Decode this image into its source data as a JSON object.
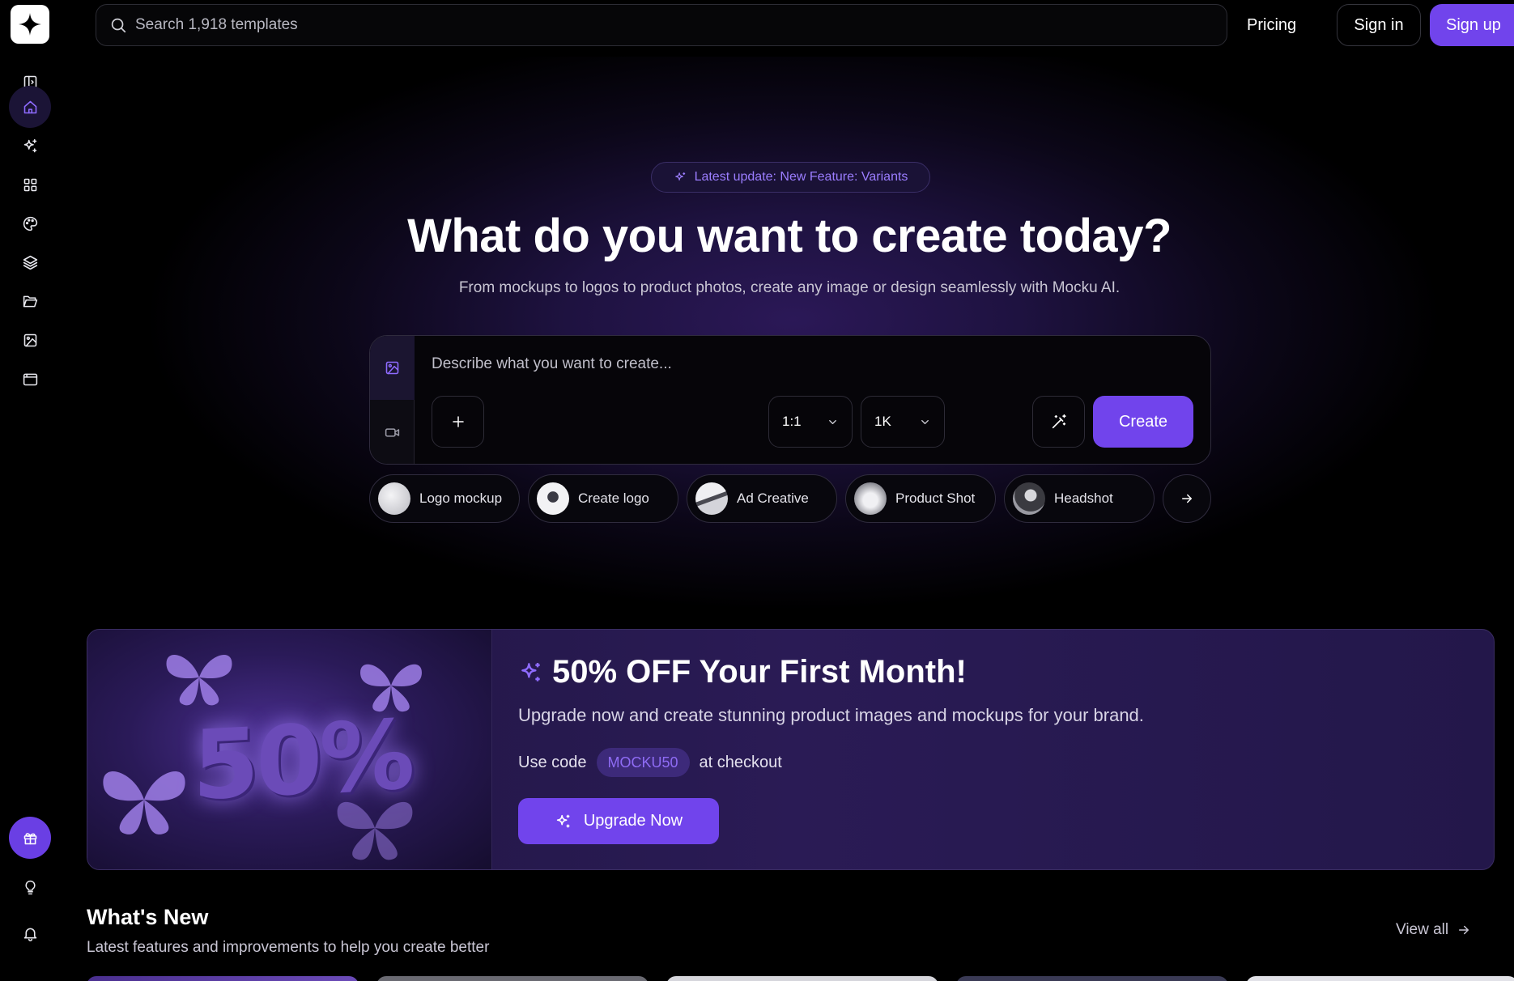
{
  "brand": {
    "name": "Mocku AI",
    "accent": "#7144ec"
  },
  "sidebar": {
    "items": [
      {
        "name": "sidebar-toggle",
        "icon": "panel-icon"
      },
      {
        "name": "home",
        "icon": "home-icon",
        "active": true
      },
      {
        "name": "ai-generate",
        "icon": "sparkles-icon"
      },
      {
        "name": "templates",
        "icon": "grid-icon"
      },
      {
        "name": "brand-kit",
        "icon": "palette-icon"
      },
      {
        "name": "layers",
        "icon": "layers-icon"
      },
      {
        "name": "projects",
        "icon": "folder-icon"
      },
      {
        "name": "images",
        "icon": "image-icon"
      },
      {
        "name": "browser",
        "icon": "browser-icon"
      }
    ],
    "bottom": [
      {
        "name": "gift",
        "icon": "gift-icon"
      },
      {
        "name": "ideas",
        "icon": "lightbulb-icon"
      },
      {
        "name": "notifications",
        "icon": "bell-icon"
      }
    ]
  },
  "header": {
    "search_placeholder": "Search 1,918 templates",
    "pricing": "Pricing",
    "sign_in": "Sign in",
    "sign_up": "Sign up"
  },
  "hero": {
    "badge": "Latest update: New Feature: Variants",
    "title": "What do you want to create today?",
    "subtitle": "From mockups to logos to product photos, create any image or design seamlessly with Mocku AI.",
    "prompt_placeholder": "Describe what you want to create...",
    "aspect_ratio": "1:1",
    "resolution": "1K",
    "create_label": "Create",
    "chips": [
      {
        "label": "Logo mockup",
        "thumb": "#d9d9dd"
      },
      {
        "label": "Create logo",
        "thumb": "#f2f2f4"
      },
      {
        "label": "Ad Creative",
        "thumb": "#c9c9cf"
      },
      {
        "label": "Product Shot",
        "thumb": "#bdbdc4"
      },
      {
        "label": "Headshot",
        "thumb": "#8a8a92"
      }
    ]
  },
  "promo": {
    "image_text": "50%",
    "title": "50% OFF Your First Month!",
    "subtitle": "Upgrade now and create stunning product images and mockups for your brand.",
    "code_prefix": "Use code",
    "code": "MOCKU50",
    "code_suffix": "at checkout",
    "button": "Upgrade Now"
  },
  "whats_new": {
    "title": "What's New",
    "subtitle": "Latest features and improvements to help you create better",
    "view_all": "View all"
  }
}
